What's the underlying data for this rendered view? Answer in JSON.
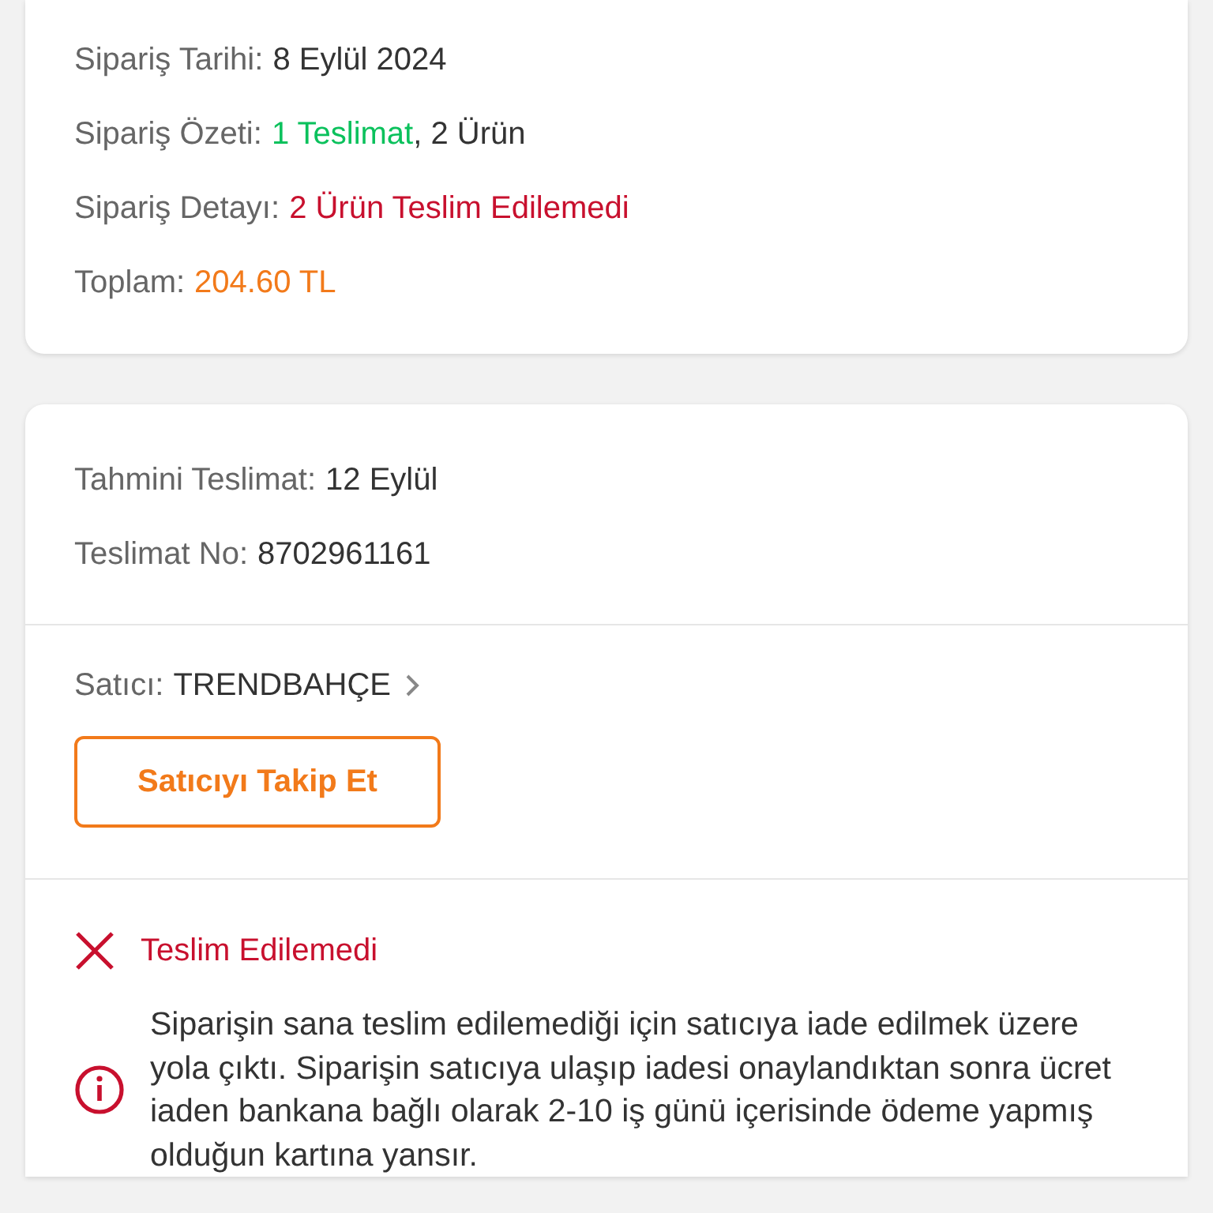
{
  "order_info": {
    "rows": [
      {
        "label": "Sipariş Tarihi:",
        "parts": [
          {
            "text": "8 Eylül 2024",
            "color": "#333333"
          }
        ]
      },
      {
        "label": "Sipariş Özeti:",
        "parts": [
          {
            "text": "1 Teslimat",
            "color": "#0bc15c"
          },
          {
            "text": ", 2 Ürün",
            "color": "#333333"
          }
        ]
      },
      {
        "label": "Sipariş Detayı:",
        "parts": [
          {
            "text": "2 Ürün Teslim Edilemedi",
            "color": "#c8102e"
          }
        ]
      },
      {
        "label": "Toplam:",
        "parts": [
          {
            "text": "204.60 TL",
            "color": "#f27a1a"
          }
        ]
      }
    ]
  },
  "shipment": {
    "rows": [
      {
        "label": "Tahmini Teslimat:",
        "value": "12 Eylül"
      },
      {
        "label": "Teslimat No:",
        "value": "8702961161"
      }
    ],
    "seller": {
      "label": "Satıcı:",
      "name": "TRENDBAHÇE"
    },
    "follow_button": "Satıcıyı Takip Et",
    "status": {
      "kind": "failed",
      "title": "Teslim Edilemedi",
      "message": "Siparişin sana teslim edilemediği için satıcıya iade edilmek üzere yola çıktı. Siparişin satıcıya ulaşıp iadesi onaylandıktan sonra ücret iaden bankana bağlı olarak 2-10 iş günü içerisinde ödeme yapmış olduğun kartına yansır."
    }
  }
}
